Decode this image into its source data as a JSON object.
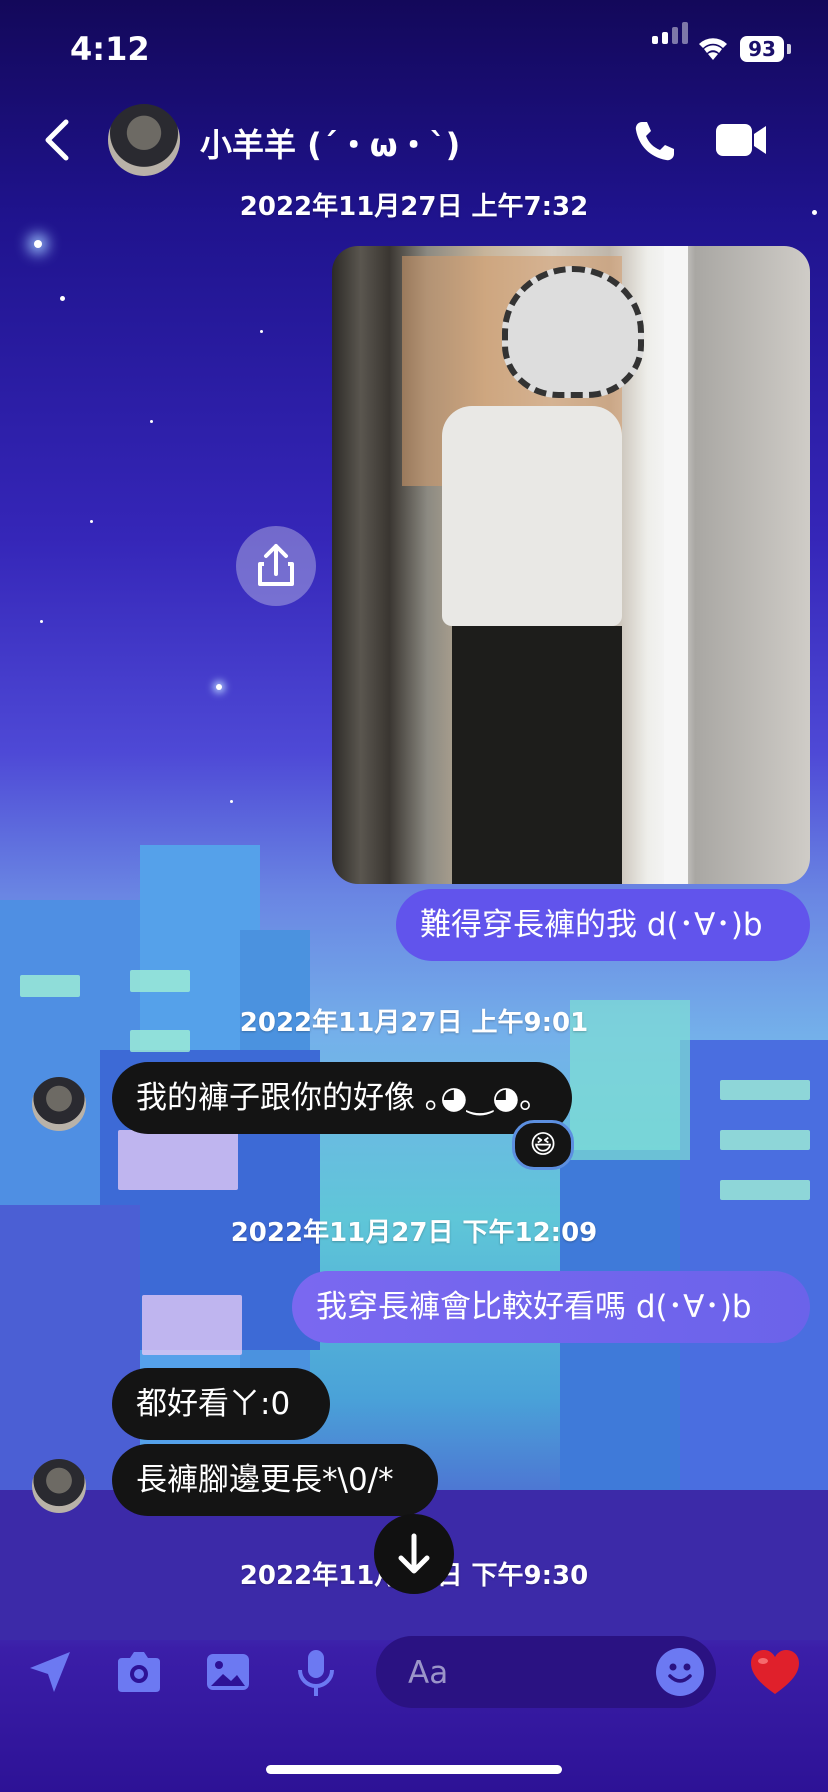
{
  "status_bar": {
    "time": "4:12",
    "battery": "93"
  },
  "header": {
    "contact_name": "小羊羊 (´・ω・`)"
  },
  "messages": {
    "timestamp_1": "2022年11月27日 上午7:32",
    "out_1": "難得穿長褲的我 d(･∀･)b",
    "timestamp_2": "2022年11月27日 上午9:01",
    "in_1": "我的褲子跟你的好像 ｡◕‿◕｡",
    "in_1_reaction": "😆",
    "timestamp_3": "2022年11月27日 下午12:09",
    "out_2": "我穿長褲會比較好看嗎 d(･∀･)b",
    "in_2": "都好看ㄚ:0",
    "in_3": "長褲腳邊更長*\\0/*",
    "timestamp_4": "2022年11月27日 下午9:30"
  },
  "composer": {
    "placeholder": "Aa"
  },
  "colors": {
    "accent": "#6154ec",
    "incoming": "#141414",
    "heart": "#e0202b"
  },
  "icons": [
    "back-arrow-icon",
    "phone-icon",
    "video-camera-icon",
    "share-icon",
    "location-arrow-icon",
    "camera-icon",
    "image-icon",
    "microphone-icon",
    "emoji-icon",
    "heart-icon",
    "arrow-down-icon"
  ]
}
